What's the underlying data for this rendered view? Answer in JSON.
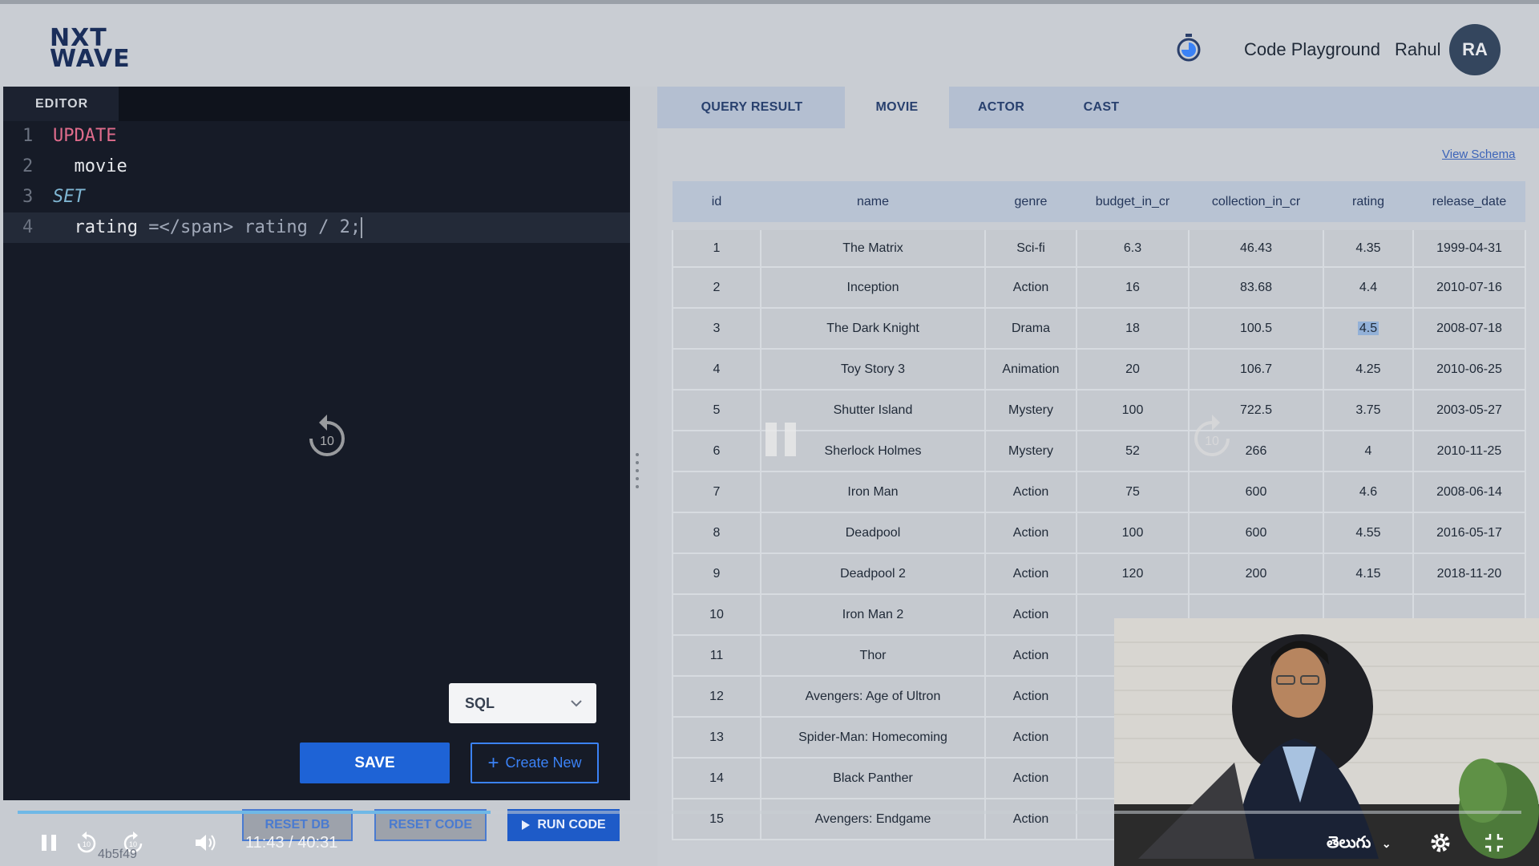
{
  "header": {
    "logo_line1": "NXT",
    "logo_line2": "WAVE",
    "playground_label": "Code Playground",
    "user_name": "Rahul",
    "avatar_initials": "RA"
  },
  "editor": {
    "tab_label": "EDITOR",
    "lines": [
      {
        "num": "1",
        "text": "UPDATE"
      },
      {
        "num": "2",
        "text": "  movie"
      },
      {
        "num": "3",
        "text": "SET"
      },
      {
        "num": "4",
        "text": "  rating = rating / 2;"
      }
    ],
    "language": "SQL",
    "save_label": "SAVE",
    "create_new_label": "Create New",
    "reset_db_label": "RESET DB",
    "reset_code_label": "RESET CODE",
    "run_code_label": "RUN CODE"
  },
  "results": {
    "tabs": [
      "QUERY RESULT",
      "MOVIE",
      "ACTOR",
      "CAST"
    ],
    "active_tab": "MOVIE",
    "view_schema_label": "View Schema",
    "columns": [
      "id",
      "name",
      "genre",
      "budget_in_cr",
      "collection_in_cr",
      "rating",
      "release_date"
    ],
    "rows": [
      [
        "1",
        "The Matrix",
        "Sci-fi",
        "6.3",
        "46.43",
        "4.35",
        "1999-04-31"
      ],
      [
        "2",
        "Inception",
        "Action",
        "16",
        "83.68",
        "4.4",
        "2010-07-16"
      ],
      [
        "3",
        "The Dark Knight",
        "Drama",
        "18",
        "100.5",
        "4.5",
        "2008-07-18"
      ],
      [
        "4",
        "Toy Story 3",
        "Animation",
        "20",
        "106.7",
        "4.25",
        "2010-06-25"
      ],
      [
        "5",
        "Shutter Island",
        "Mystery",
        "100",
        "722.5",
        "3.75",
        "2003-05-27"
      ],
      [
        "6",
        "Sherlock Holmes",
        "Mystery",
        "52",
        "266",
        "4",
        "2010-11-25"
      ],
      [
        "7",
        "Iron Man",
        "Action",
        "75",
        "600",
        "4.6",
        "2008-06-14"
      ],
      [
        "8",
        "Deadpool",
        "Action",
        "100",
        "600",
        "4.55",
        "2016-05-17"
      ],
      [
        "9",
        "Deadpool 2",
        "Action",
        "120",
        "200",
        "4.15",
        "2018-11-20"
      ],
      [
        "10",
        "Iron Man 2",
        "Action",
        "",
        "",
        "",
        ""
      ],
      [
        "11",
        "Thor",
        "Action",
        "",
        "",
        "",
        ""
      ],
      [
        "12",
        "Avengers: Age of Ultron",
        "Action",
        "",
        "",
        "",
        ""
      ],
      [
        "13",
        "Spider-Man: Homecoming",
        "Action",
        "",
        "",
        "",
        ""
      ],
      [
        "14",
        "Black Panther",
        "Action",
        "",
        "",
        "",
        ""
      ],
      [
        "15",
        "Avengers: Endgame",
        "Action",
        "",
        "",
        "",
        ""
      ]
    ],
    "selected_cell": {
      "row": 2,
      "col": 5
    }
  },
  "video": {
    "progress": 0.3145,
    "current_time": "11:43",
    "separator": "/",
    "duration": "40:31",
    "video_id": "4b5f49",
    "language_label": "తెలుగు",
    "seek_seconds": "10"
  },
  "colors": {
    "accent": "#1e63d6",
    "progress": "#6fb8e6",
    "avatar": "#34465e"
  },
  "icons": {
    "timer": "stopwatch-icon",
    "pause": "pause-icon",
    "rewind": "rewind-10-icon",
    "forward": "forward-10-icon",
    "volume": "volume-icon",
    "settings": "gear-icon",
    "fullscreen": "exit-fullscreen-icon"
  }
}
